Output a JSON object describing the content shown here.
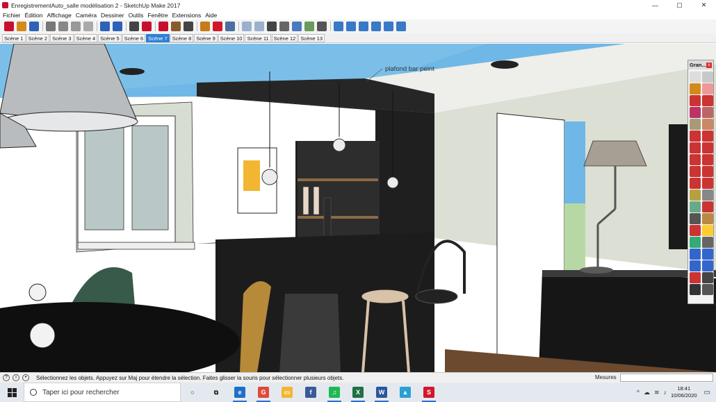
{
  "window": {
    "title": "EnregistrementAuto_salle modélisation 2 - SketchUp Make 2017",
    "minimize": "—",
    "maximize": "▢",
    "close": "✕"
  },
  "menu": [
    "Fichier",
    "Édition",
    "Affichage",
    "Caméra",
    "Dessiner",
    "Outils",
    "Fenêtre",
    "Extensions",
    "Aide"
  ],
  "toolbar": {
    "icons": [
      "new-file",
      "open-folder",
      "save",
      "cut",
      "copy",
      "paste",
      "erase",
      "undo",
      "redo",
      "print",
      "model-info",
      "warehouse",
      "share-model",
      "components",
      "get-photo",
      "extension-warehouse",
      "styles",
      "xray",
      "back-edges",
      "wireframe",
      "hidden-line",
      "shaded",
      "shaded-textures",
      "monochrome",
      "iso-view",
      "top-view",
      "front-view",
      "right-view",
      "back-view",
      "left-view"
    ]
  },
  "scenes": {
    "tabs": [
      "Scène 1",
      "Scène 2",
      "Scène 3",
      "Scène 4",
      "Scène 5",
      "Scène 6",
      "Scène 7",
      "Scène 8",
      "Scène 9",
      "Scène 10",
      "Scène 11",
      "Scène 12",
      "Scène 13"
    ],
    "active": "Scène 7"
  },
  "viewport": {
    "annotation": "plafond bar peint"
  },
  "palette": {
    "title": "Gran...",
    "close": "x",
    "tools": [
      "select",
      "make-component",
      "paint-bucket",
      "eraser",
      "line",
      "freehand",
      "rectangle",
      "rotated-rectangle",
      "circle",
      "polygon",
      "arc",
      "two-point-arc",
      "pie",
      "three-point-arc",
      "move",
      "push-pull",
      "rotate",
      "follow-me",
      "scale",
      "offset",
      "tape-measure",
      "text",
      "protractor",
      "axes",
      "dimension",
      "3d-text",
      "section-plane",
      "paint",
      "orbit",
      "pan",
      "zoom",
      "zoom-window",
      "zoom-extents",
      "previous",
      "position-camera",
      "look-around",
      "walk",
      "section"
    ]
  },
  "status": {
    "message": "Sélectionnez les objets. Appuyez sur Maj pour étendre la sélection. Faites glisser la souris pour sélectionner plusieurs objets.",
    "measure_label": "Mesures",
    "measure_value": ""
  },
  "taskbar": {
    "search_placeholder": "Taper ici pour rechercher",
    "apps": [
      {
        "name": "cortana",
        "glyph": "○",
        "color": "#e4e9ef"
      },
      {
        "name": "task-view",
        "glyph": "⧉",
        "color": "#e4e9ef"
      },
      {
        "name": "edge",
        "glyph": "e",
        "color": "#1f6fc5"
      },
      {
        "name": "chrome",
        "glyph": "G",
        "color": "#dd4b39"
      },
      {
        "name": "file-explorer",
        "glyph": "▭",
        "color": "#f2b632"
      },
      {
        "name": "facebook",
        "glyph": "f",
        "color": "#3b5998"
      },
      {
        "name": "spotify",
        "glyph": "♫",
        "color": "#1db954"
      },
      {
        "name": "excel",
        "glyph": "X",
        "color": "#1e7145"
      },
      {
        "name": "word",
        "glyph": "W",
        "color": "#2b579a"
      },
      {
        "name": "photos",
        "glyph": "▲",
        "color": "#2a9fd6"
      },
      {
        "name": "sketchup",
        "glyph": "S",
        "color": "#d0182d"
      }
    ],
    "time": "18:41",
    "date": "10/06/2020"
  }
}
